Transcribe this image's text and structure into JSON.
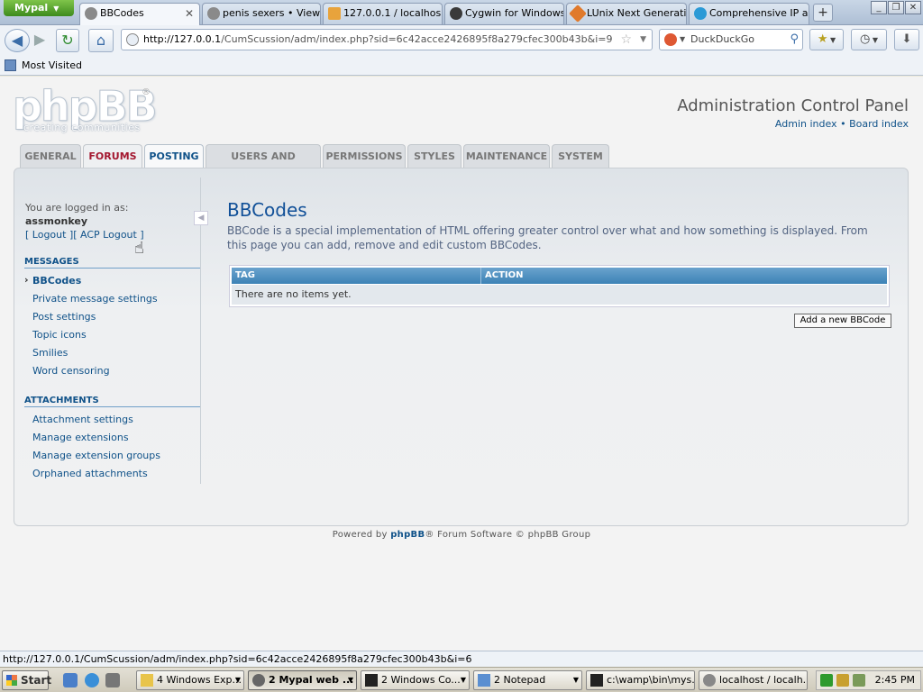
{
  "browser": {
    "app_menu": "Mypal",
    "tabs": [
      {
        "label": "BBCodes",
        "active": true
      },
      {
        "label": "penis sexers • View ..."
      },
      {
        "label": "127.0.0.1 / localhos..."
      },
      {
        "label": "Cygwin for Windows..."
      },
      {
        "label": "LUnix Next Generati..."
      },
      {
        "label": "Comprehensive IP a..."
      }
    ],
    "new_tab": "+",
    "url_host": "http://127.0.0.1",
    "url_path": "/CumScussion/adm/index.php?sid=6c42acce2426895f8a279cfec300b43b&i=9",
    "search_placeholder": "DuckDuckGo",
    "bookmark_item": "Most Visited",
    "status_url": "http://127.0.0.1/CumScussion/adm/index.php?sid=6c42acce2426895f8a279cfec300b43b&i=6"
  },
  "header": {
    "logo_text": "phpBB",
    "logo_reg": "®",
    "logo_tagline": "creating communities",
    "title": "Administration Control Panel",
    "link_admin_index": "Admin index",
    "link_sep": "•",
    "link_board_index": "Board index"
  },
  "main_tabs": [
    {
      "label": "GENERAL"
    },
    {
      "label": "FORUMS"
    },
    {
      "label": "POSTING"
    },
    {
      "label": "USERS AND GROUPS"
    },
    {
      "label": "PERMISSIONS"
    },
    {
      "label": "STYLES"
    },
    {
      "label": "MAINTENANCE"
    },
    {
      "label": "SYSTEM"
    }
  ],
  "sidebar": {
    "logged_in_label": "You are logged in as:",
    "username": "assmonkey",
    "logout": "[ Logout ]",
    "acp_logout": "[ ACP Logout ]",
    "collapse_glyph": "◀",
    "sections": [
      {
        "heading": "MESSAGES",
        "items": [
          {
            "label": "BBCodes"
          },
          {
            "label": "Private message settings"
          },
          {
            "label": "Post settings"
          },
          {
            "label": "Topic icons"
          },
          {
            "label": "Smilies"
          },
          {
            "label": "Word censoring"
          }
        ]
      },
      {
        "heading": "ATTACHMENTS",
        "items": [
          {
            "label": "Attachment settings"
          },
          {
            "label": "Manage extensions"
          },
          {
            "label": "Manage extension groups"
          },
          {
            "label": "Orphaned attachments"
          }
        ]
      }
    ]
  },
  "content": {
    "title": "BBCodes",
    "description": "BBCode is a special implementation of HTML offering greater control over what and how something is displayed. From this page you can add, remove and edit custom BBCodes.",
    "table": {
      "columns": [
        "TAG",
        "ACTION"
      ],
      "empty_text": "There are no items yet."
    },
    "add_button": "Add a new BBCode"
  },
  "footer": {
    "powered_prefix": "Powered by",
    "powered_brand": "phpBB",
    "powered_suffix": "® Forum Software © phpBB Group"
  },
  "taskbar": {
    "start": "Start",
    "tasks": [
      {
        "label": "4 Windows Exp..."
      },
      {
        "label": "2 Mypal web ...",
        "active": true
      },
      {
        "label": "2 Windows Co..."
      },
      {
        "label": "2 Notepad"
      },
      {
        "label": "c:\\wamp\\bin\\mys..."
      },
      {
        "label": "localhost / localh..."
      }
    ],
    "clock": "2:45 PM"
  },
  "colors": {
    "link": "#105289",
    "hover_tab": "#a3172f",
    "table_header": "#3c82b6"
  }
}
